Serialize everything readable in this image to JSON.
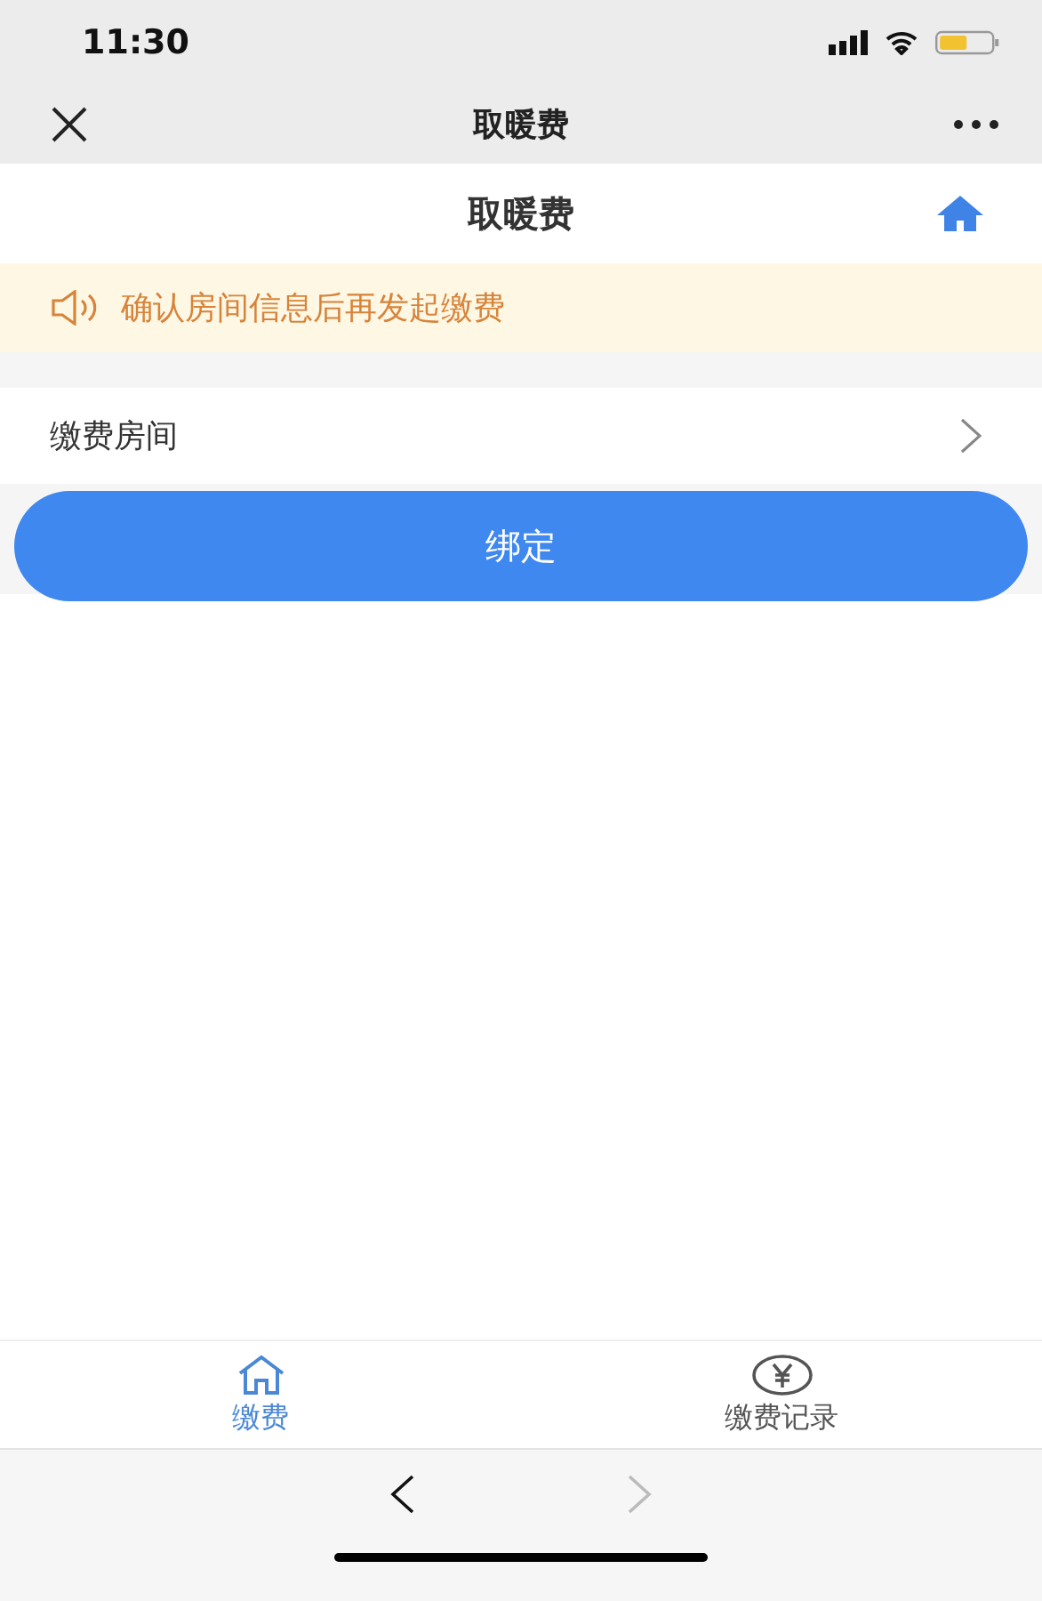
{
  "status_bar": {
    "time": "11:30"
  },
  "nav_bar": {
    "title": "取暖费"
  },
  "header": {
    "title": "取暖费"
  },
  "notice": {
    "text": "确认房间信息后再发起缴费"
  },
  "room_row": {
    "label": "缴费房间"
  },
  "bind_button": {
    "label": "绑定"
  },
  "tabs": [
    {
      "label": "缴费",
      "kind": "home",
      "selected": true
    },
    {
      "label": "缴费记录",
      "kind": "yen",
      "selected": false
    }
  ],
  "browser_bar": {
    "back_disabled": false,
    "forward_disabled": true
  }
}
